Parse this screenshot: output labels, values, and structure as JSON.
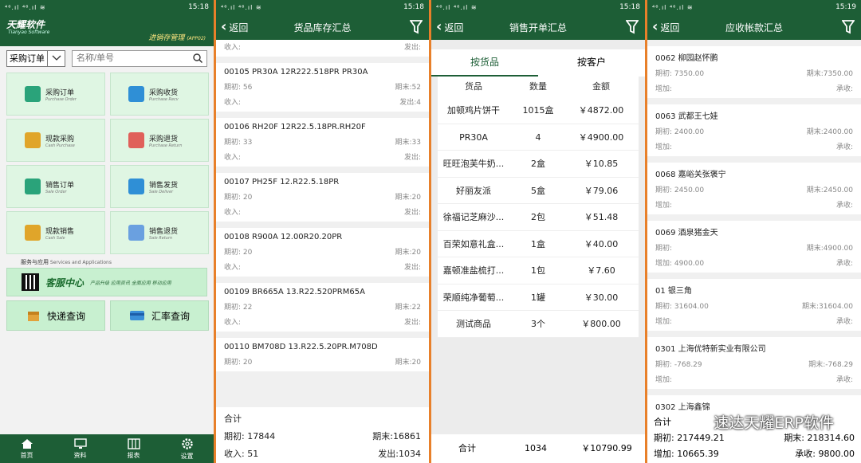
{
  "status": {
    "time1": "15:18",
    "time2": "15:18",
    "time3": "15:18",
    "time4": "15:19",
    "signal": "⁴⁶.ıl ⁴⁶.ıl ≋",
    "battery": "▭"
  },
  "home": {
    "logo": "天耀软件",
    "logo_sub": "Tianyao Software",
    "app_title": "进销存管理",
    "app_code": "(APP02)",
    "select_value": "采购订单",
    "search_placeholder": "名称/单号",
    "tiles": [
      {
        "label": "采购订单",
        "sub": "Purchase Order",
        "color": "#2aa37a"
      },
      {
        "label": "采购收货",
        "sub": "Purchase Recv",
        "color": "#2f8fd6"
      },
      {
        "label": "现款采购",
        "sub": "Cash Purchase",
        "color": "#e0a52a"
      },
      {
        "label": "采购退货",
        "sub": "Purchase Return",
        "color": "#e0605a"
      },
      {
        "label": "销售订单",
        "sub": "Sale Order",
        "color": "#2aa37a"
      },
      {
        "label": "销售发货",
        "sub": "Sale Deliver",
        "color": "#2f8fd6"
      },
      {
        "label": "现款销售",
        "sub": "Cash Sale",
        "color": "#e0a52a"
      },
      {
        "label": "销售退货",
        "sub": "Sale Return",
        "color": "#6aa0e0"
      }
    ],
    "service_label": "服务与应用",
    "service_sub": "Services and Applications",
    "kefu_title": "客服中心",
    "kefu_sub": "产品升级 应用资讯 全面应用 移动应用",
    "quick_query": "快递查询",
    "rate_query": "汇率查询",
    "tabbar": [
      "首页",
      "资料",
      "报表",
      "设置"
    ]
  },
  "stock": {
    "back": "返回",
    "title": "货品库存汇总",
    "top_partial": {
      "in": "收入:",
      "out": "发出:"
    },
    "items": [
      {
        "title": "00105 PR30A 12R222.518PR PR30A",
        "begin": "期初: 56",
        "end": "期末:52",
        "in": "收入:",
        "out": "发出:4"
      },
      {
        "title": "00106 RH20F 12R22.5.18PR.RH20F",
        "begin": "期初: 33",
        "end": "期末:33",
        "in": "收入:",
        "out": "发出:"
      },
      {
        "title": "00107 PH25F 12.R22.5.18PR",
        "begin": "期初: 20",
        "end": "期末:20",
        "in": "收入:",
        "out": "发出:"
      },
      {
        "title": "00108 R900A 12.00R20.20PR",
        "begin": "期初: 20",
        "end": "期末:20",
        "in": "收入:",
        "out": "发出:"
      },
      {
        "title": "00109 BR665A 13.R22.520PRM65A",
        "begin": "期初: 22",
        "end": "期末:22",
        "in": "收入:",
        "out": "发出:"
      },
      {
        "title": "00110 BM708D 13.R22.5.20PR.M708D",
        "begin": "期初: 20",
        "end": "期末:20",
        "in": "收入:",
        "out": "发出:"
      }
    ],
    "summary": {
      "label": "合计",
      "begin": "期初: 17844",
      "end": "期末:16861",
      "in": "收入: 51",
      "out": "发出:1034"
    }
  },
  "sales": {
    "back": "返回",
    "title": "销售开单汇总",
    "tab_goods": "按货品",
    "tab_customer": "按客户",
    "headers": [
      "货品",
      "数量",
      "金额"
    ],
    "rows": [
      [
        "加顿鸡片饼干",
        "1015盒",
        "￥4872.00"
      ],
      [
        "PR30A",
        "4",
        "￥4900.00"
      ],
      [
        "旺旺泡芙牛奶...",
        "2盒",
        "￥10.85"
      ],
      [
        "好丽友派",
        "5盒",
        "￥79.06"
      ],
      [
        "徐福记芝麻沙...",
        "2包",
        "￥51.48"
      ],
      [
        "百荣如意礼盒...",
        "1盒",
        "￥40.00"
      ],
      [
        "嘉顿准盐梳打...",
        "1包",
        "￥7.60"
      ],
      [
        "荣顺纯净葡萄...",
        "1罐",
        "￥30.00"
      ],
      [
        "测试商品",
        "3个",
        "￥800.00"
      ]
    ],
    "footer": [
      "合计",
      "1034",
      "￥10790.99"
    ]
  },
  "ar": {
    "back": "返回",
    "title": "应收帐款汇总",
    "items": [
      {
        "title": "0062 柳园赵怀鹏",
        "begin": "期初: 7350.00",
        "end": "期末:7350.00",
        "add": "增加:",
        "recv": "承收:"
      },
      {
        "title": "0063 武都王七娃",
        "begin": "期初: 2400.00",
        "end": "期末:2400.00",
        "add": "增加:",
        "recv": "承收:"
      },
      {
        "title": "0068 嘉峪关张褒宁",
        "begin": "期初: 2450.00",
        "end": "期末:2450.00",
        "add": "增加:",
        "recv": "承收:"
      },
      {
        "title": "0069 酒泉猪金天",
        "begin": "期初:",
        "end": "期末:4900.00",
        "add": "增加: 4900.00",
        "recv": "承收:"
      },
      {
        "title": "01 银三角",
        "begin": "期初: 31604.00",
        "end": "期末:31604.00",
        "add": "增加:",
        "recv": "承收:"
      },
      {
        "title": "0301 上海优特新实业有限公司",
        "begin": "期初: -768.29",
        "end": "期末:-768.29",
        "add": "增加:",
        "recv": "承收:"
      }
    ],
    "partial_title": "0302 上海鑫锦",
    "summary": {
      "label": "合计",
      "begin": "期初: 217449.21",
      "end": "期末: 218314.60",
      "add": "增加: 10665.39",
      "recv": "承收: 9800.00"
    },
    "watermark": "速达天耀ERP软件"
  },
  "colors": {
    "header": "#1d5e36",
    "tile": "#dff6e3",
    "separator": "#e8802a"
  }
}
